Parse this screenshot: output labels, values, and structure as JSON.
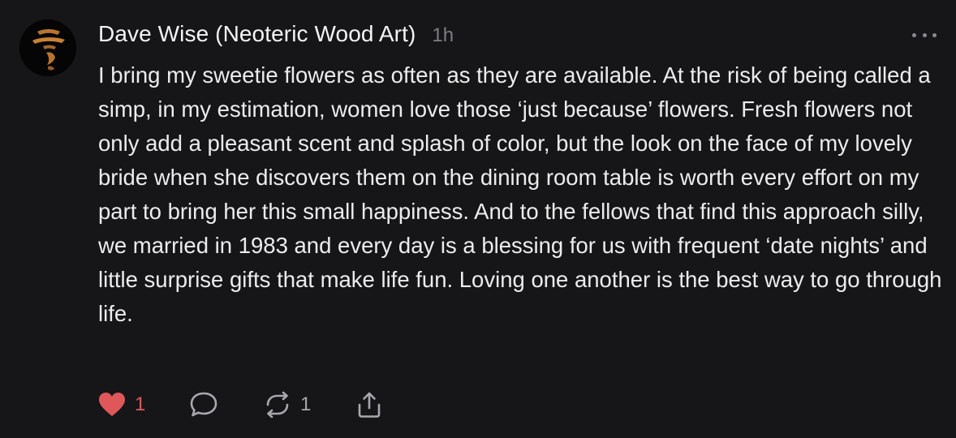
{
  "post": {
    "author": "Dave Wise (Neoteric Wood Art)",
    "timestamp": "1h",
    "text": "I bring my sweetie flowers as often as they are available. At the risk of being called a simp, in my estimation, women love those ‘just because’ flowers. Fresh flowers not only add a pleasant scent and splash of color, but the look on the face of my lovely bride when she discovers them on the dining room table is worth every effort on my part to bring her this small happiness. And to the fellows that find this approach silly, we married in 1983 and every day is a blessing for us with frequent ‘date nights’ and little surprise gifts that make life fun. Loving one another is the best way to go through life."
  },
  "actions": {
    "like_count": "1",
    "repost_count": "1",
    "liked": true
  },
  "icons": {
    "more": "more-horizontal-icon",
    "like": "heart-icon",
    "reply": "comment-bubble-icon",
    "repost": "repost-icon",
    "share": "share-icon"
  },
  "colors": {
    "background": "#161618",
    "text": "#ececec",
    "muted": "#7d7d82",
    "like_accent": "#e0575a",
    "avatar_accent": "#b8742e"
  }
}
